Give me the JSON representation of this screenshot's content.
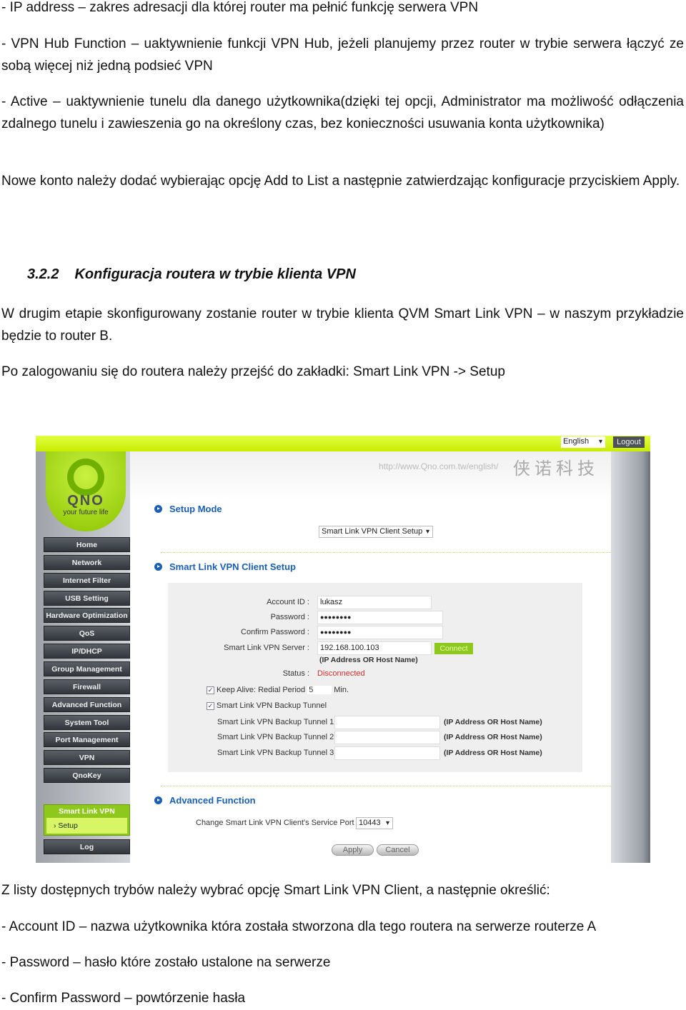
{
  "document": {
    "para1": "- IP address – zakres adresacji dla której router ma pełnić funkcję serwera VPN",
    "para2": "- VPN Hub Function – uaktywnienie funkcji VPN Hub, jeżeli planujemy przez router w trybie serwera łączyć ze sobą więcej niż jedną podsieć VPN",
    "para3": "- Active – uaktywnienie tunelu dla danego użytkownika(dzięki tej opcji, Administrator ma możliwość odłączenia zdalnego tunelu i zawieszenia go na określony czas, bez konieczności usuwania konta użytkownika)",
    "para4": "Nowe konto należy dodać wybierając opcję Add to List a następnie zatwierdzając konfiguracje przyciskiem Apply.",
    "heading_number": "3.2.2",
    "heading_title": "Konfiguracja routera w trybie klienta VPN",
    "para5": "W drugim etapie skonfigurowany zostanie router w trybie klienta QVM Smart Link VPN – w naszym przykładzie będzie to router B.",
    "para6": "Po zalogowaniu się do routera należy przejść do zakładki: Smart Link VPN -> Setup",
    "para7": "Z listy dostępnych trybów należy wybrać opcję Smart Link VPN Client, a następnie określić:",
    "para8": "- Account ID – nazwa użytkownika która została stworzona dla tego routera na serwerze routerze A",
    "para9": "- Password – hasło które zostało ustalone na serwerze",
    "para10": "- Confirm Password – powtórzenie hasła"
  },
  "router": {
    "language": "English",
    "logout": "Logout",
    "url": "http://www.Qno.com.tw/english/",
    "brand_cn": "侠诺科技",
    "logo_text": "QNO",
    "logo_tagline": "your future life",
    "nav": [
      "Home",
      "Network",
      "Internet Filter",
      "USB Setting",
      "Hardware Optimization",
      "QoS",
      "IP/DHCP",
      "Group Management",
      "Firewall",
      "Advanced Function",
      "System Tool",
      "Port Management",
      "VPN",
      "QnoKey"
    ],
    "nav_active": "Smart Link VPN",
    "nav_sub": "Setup",
    "nav_log": "Log",
    "setup_mode_title": "Setup Mode",
    "setup_mode_value": "Smart Link VPN Client Setup",
    "client_setup_title": "Smart Link VPN Client Setup",
    "account_label": "Account ID :",
    "account_value": "lukasz",
    "password_label": "Password :",
    "password_value": "●●●●●●●●",
    "confirm_label": "Confirm Password :",
    "confirm_value": "●●●●●●●●",
    "server_label": "Smart Link VPN Server :",
    "server_value": "192.168.100.103",
    "connect": "Connect",
    "host_note": "(IP Address OR Host Name)",
    "status_label": "Status :",
    "status_value": "Disconnected",
    "status_color": "#d0312d",
    "keep_alive_label": "Keep Alive: Redial Period",
    "keep_alive_value": "5",
    "keep_alive_unit": "Min.",
    "keep_alive_checked": true,
    "backup_label": "Smart Link VPN Backup Tunnel",
    "backup_checked": true,
    "tunnels": [
      "Smart Link VPN Backup Tunnel 1 :",
      "Smart Link VPN Backup Tunnel 2 :",
      "Smart Link VPN Backup Tunnel 3 :"
    ],
    "advanced_title": "Advanced Function",
    "port_label": "Change Smart Link VPN Client's Service Port :",
    "port_value": "10443",
    "apply": "Apply",
    "cancel": "Cancel"
  }
}
